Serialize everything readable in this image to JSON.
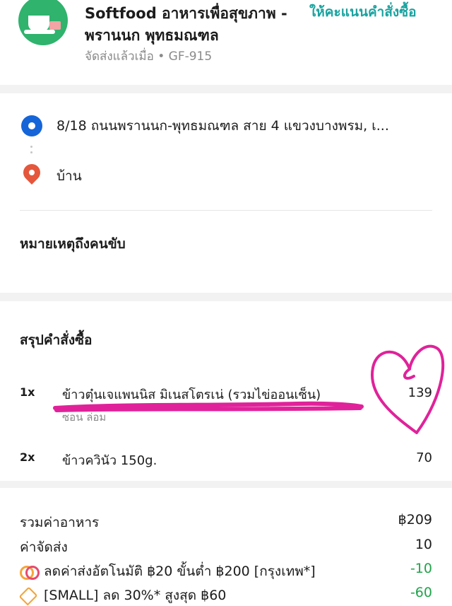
{
  "header": {
    "store_name": "Softfood อาหารเพื่อสุขภาพ - พรานนก พุทธมณฑล",
    "rate_link": "ให้คะแนนคำสั่งซื้อ",
    "status": "จัดส่งแล้วเมื่อ • GF-915"
  },
  "address": {
    "origin": "8/18 ถนนพรานนก-พุทธมณฑล สาย 4 แขวงบางพรม, เ...",
    "destination": "บ้าน"
  },
  "driver_note": {
    "title": "หมายเหตุถึงคนขับ"
  },
  "order_summary": {
    "title": "สรุปคำสั่งซื้อ",
    "items": [
      {
        "qty": "1x",
        "name": "ข้าวตุ๋นเจแพนนิส มิเนสโตรเน่ (รวมไข่ออนเซ็น)",
        "option": "ซอน ล่อม",
        "price": "139"
      },
      {
        "qty": "2x",
        "name": "ข้าวควินัว 150g.",
        "option": "",
        "price": "70"
      }
    ]
  },
  "totals": {
    "food_label": "รวมค่าอาหาร",
    "food_value": "฿209",
    "delivery_label": "ค่าจัดส่ง",
    "delivery_value": "10",
    "promo1_label": "ลดค่าส่งอัตโนมัติ ฿20 ขั้นต่ำ ฿200 [กรุงเทพ*]",
    "promo1_value": "-10",
    "promo2_label": "[SMALL] ลด 30%* สูงสุด ฿60",
    "promo2_value": "-60"
  },
  "colors": {
    "accent": "#1aa3a0",
    "discount": "#21a34a",
    "origin_pin": "#1565d8",
    "destination_pin": "#e4573d",
    "scribble": "#e0229a"
  },
  "icons": [
    "store-logo",
    "origin-pin-icon",
    "destination-pin-icon",
    "promo-rings-icon",
    "tag-icon"
  ]
}
